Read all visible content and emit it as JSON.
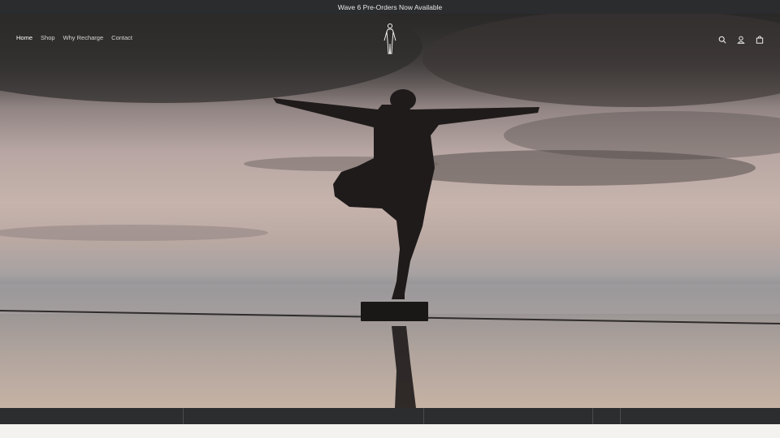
{
  "announcement": {
    "text": "Wave 6 Pre-Orders Now Available"
  },
  "nav": {
    "items": [
      {
        "label": "Home",
        "active": true
      },
      {
        "label": "Shop"
      },
      {
        "label": "Why Recharge"
      },
      {
        "label": "Contact"
      }
    ]
  },
  "header": {
    "logo_icon": "standing-figure-icon",
    "icons": [
      "search-icon",
      "account-icon",
      "cart-icon"
    ]
  },
  "hero": {
    "image": "silhouette-balancing-on-one-leg-at-sunset-over-water"
  }
}
